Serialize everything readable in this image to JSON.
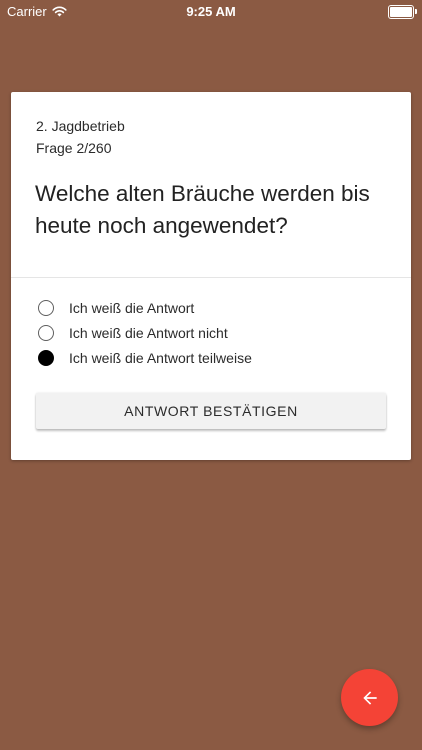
{
  "status_bar": {
    "carrier": "Carrier",
    "time": "9:25 AM"
  },
  "quiz": {
    "category": "2. Jagdbetrieb",
    "counter": "Frage 2/260",
    "question": "Welche alten Bräuche werden bis heute noch angewendet?",
    "options": [
      {
        "label": "Ich weiß die Antwort",
        "selected": false
      },
      {
        "label": "Ich weiß die Antwort nicht",
        "selected": false
      },
      {
        "label": "Ich weiß die Antwort teilweise",
        "selected": true
      }
    ],
    "confirm_label": "ANTWORT BESTÄTIGEN"
  },
  "fab": {
    "icon": "arrow-left-icon"
  },
  "colors": {
    "background": "#8B5A43",
    "card": "#FFFFFF",
    "fab": "#F44336"
  }
}
